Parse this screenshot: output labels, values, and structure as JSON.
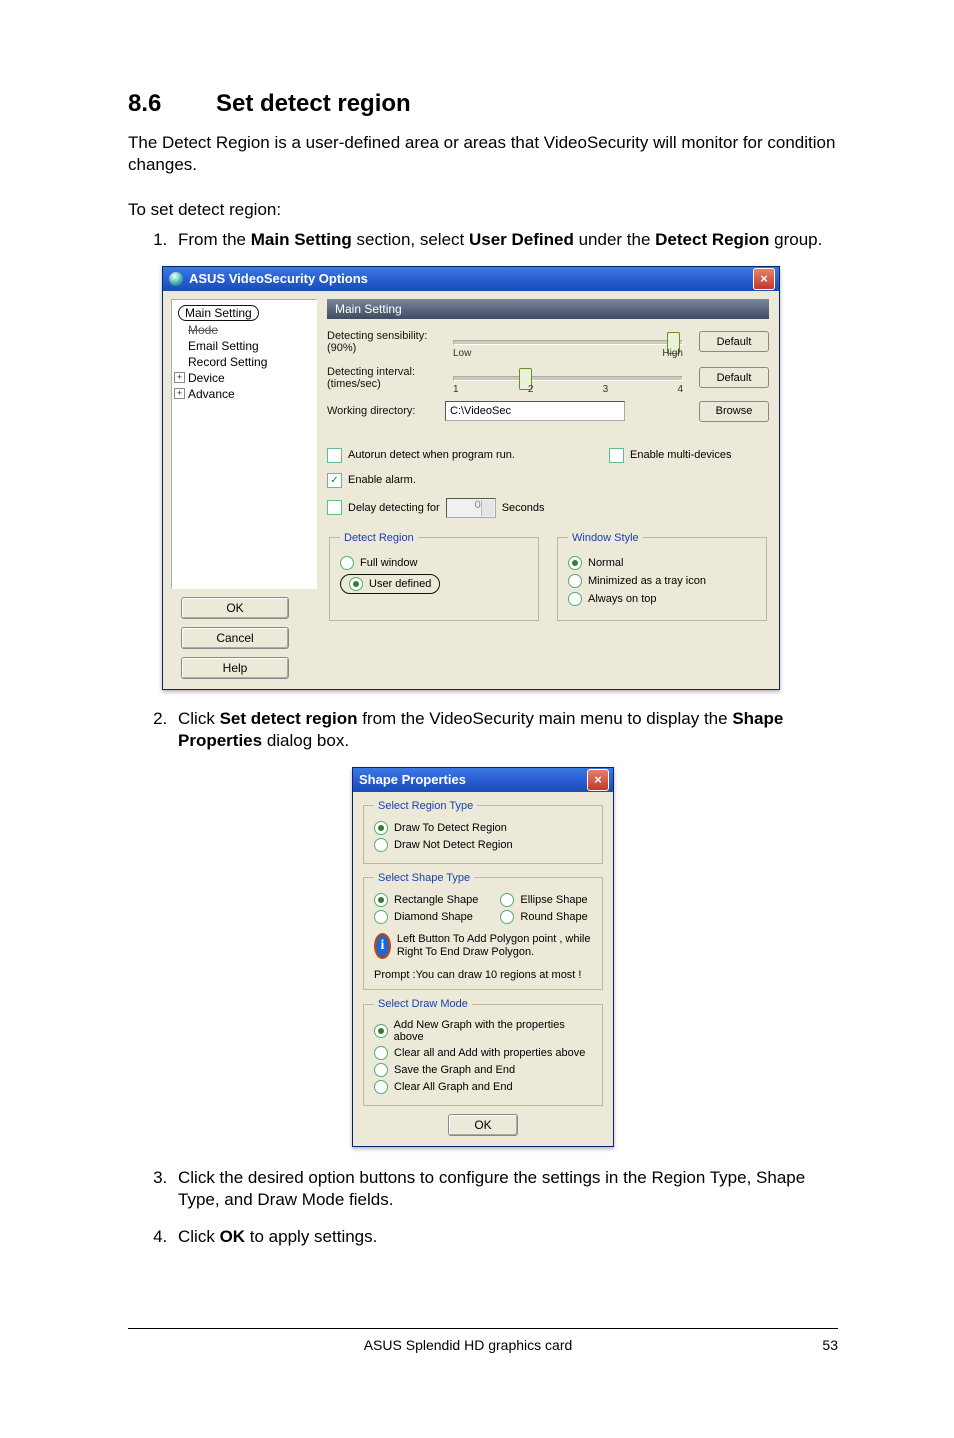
{
  "heading": {
    "number": "8.6",
    "title": "Set detect region"
  },
  "intro": "The Detect Region is a user-defined area or areas that VideoSecurity will monitor for condition changes.",
  "lead_in": "To set detect region:",
  "steps": {
    "s1_a": "From the ",
    "s1_b": "Main Setting",
    "s1_c": " section, select ",
    "s1_d": "User Defined",
    "s1_e": " under the ",
    "s1_f": "Detect Region",
    "s1_g": " group.",
    "s2_a": "Click ",
    "s2_b": "Set detect region",
    "s2_c": " from the VideoSecurity main menu to display the ",
    "s2_d": "Shape Properties",
    "s2_e": " dialog box.",
    "s3": "Click the desired option buttons to configure the settings in the Region Type, Shape Type, and Draw Mode fields.",
    "s4_a": "Click ",
    "s4_b": "OK",
    "s4_c": " to apply settings."
  },
  "options_window": {
    "title": "ASUS VideoSecurity Options",
    "tree": {
      "root": "Main Setting",
      "items": [
        "Mode",
        "Email Setting",
        "Record Setting",
        "Device",
        "Advance"
      ]
    },
    "buttons": {
      "ok": "OK",
      "cancel": "Cancel",
      "help": "Help"
    },
    "panel_title": "Main Setting",
    "sensibility_label": "Detecting sensibility:",
    "sensibility_value": "(90%)",
    "low": "Low",
    "high": "High",
    "default_btn": "Default",
    "interval_label": "Detecting interval:",
    "interval_unit": "(times/sec)",
    "ticks": [
      "1",
      "2",
      "3",
      "4"
    ],
    "workdir_label": "Working directory:",
    "workdir_value": "C:\\VideoSec",
    "browse_btn": "Browse",
    "autorun": "Autorun detect when program run.",
    "enable_multi": "Enable multi-devices",
    "enable_alarm": "Enable alarm.",
    "delay_label": "Delay detecting for",
    "delay_value": "0",
    "seconds": "Seconds",
    "detect_region": {
      "legend": "Detect Region",
      "full": "Full window",
      "user": "User defined"
    },
    "window_style": {
      "legend": "Window Style",
      "normal": "Normal",
      "tray": "Minimized as a tray icon",
      "top": "Always on top"
    }
  },
  "shape_window": {
    "title": "Shape Properties",
    "region_type": {
      "legend": "Select Region Type",
      "draw_to": "Draw To  Detect Region",
      "draw_not": "Draw Not Detect Region"
    },
    "shape_type": {
      "legend": "Select Shape Type",
      "rect": "Rectangle Shape",
      "ellipse": "Ellipse Shape",
      "diamond": "Diamond Shape",
      "round": "Round Shape",
      "hint": "Left  Button To Add Polygon point , while Right To End Draw Polygon.",
      "prompt": "Prompt :You can draw 10 regions at most !"
    },
    "draw_mode": {
      "legend": "Select Draw Mode",
      "add_new": "Add New Graph with the properties above",
      "clear_add": "Clear all and Add with properties above",
      "save_end": "Save the Graph and End",
      "clear_end": "Clear All Graph and End"
    },
    "ok": "OK"
  },
  "footer": {
    "text": "ASUS Splendid HD graphics card",
    "page": "53"
  }
}
